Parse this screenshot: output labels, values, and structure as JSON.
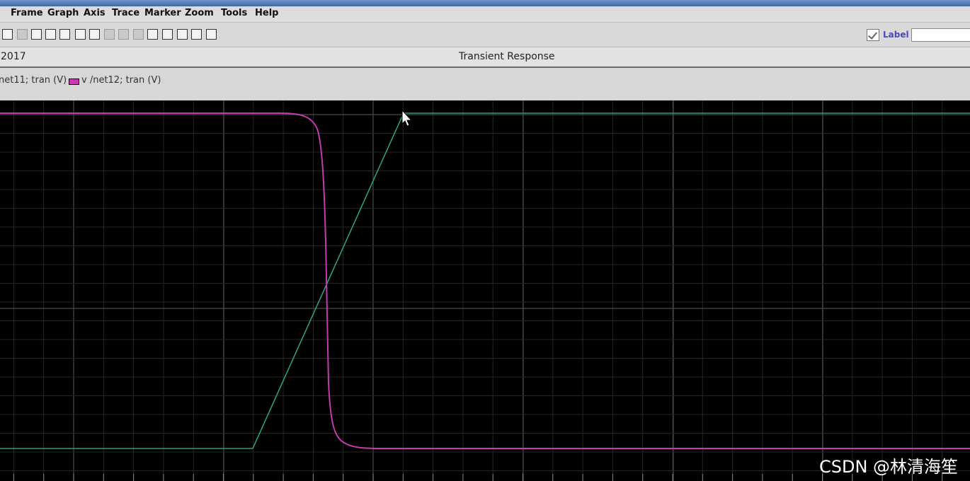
{
  "menu": [
    "Frame",
    "Graph",
    "Axis",
    "Trace",
    "Marker",
    "Zoom",
    "Tools",
    "Help"
  ],
  "toolbar": {
    "label_text": "Label",
    "label_input_value": ""
  },
  "info": {
    "date_fragment": "2017",
    "plot_title": "Transient Response"
  },
  "legend": [
    {
      "name": "net11; tran (V)",
      "color": "#2e9b7e"
    },
    {
      "name": "v /net12; tran (V)",
      "color": "#c23bb0"
    }
  ],
  "colors": {
    "plot_background": "#000000",
    "grid_major": "#4a4a4a",
    "grid_minor": "#262626",
    "input_trace": "#2e9b7e",
    "output_trace": "#c23bb0"
  },
  "watermark": "CSDN @林清海笙"
}
